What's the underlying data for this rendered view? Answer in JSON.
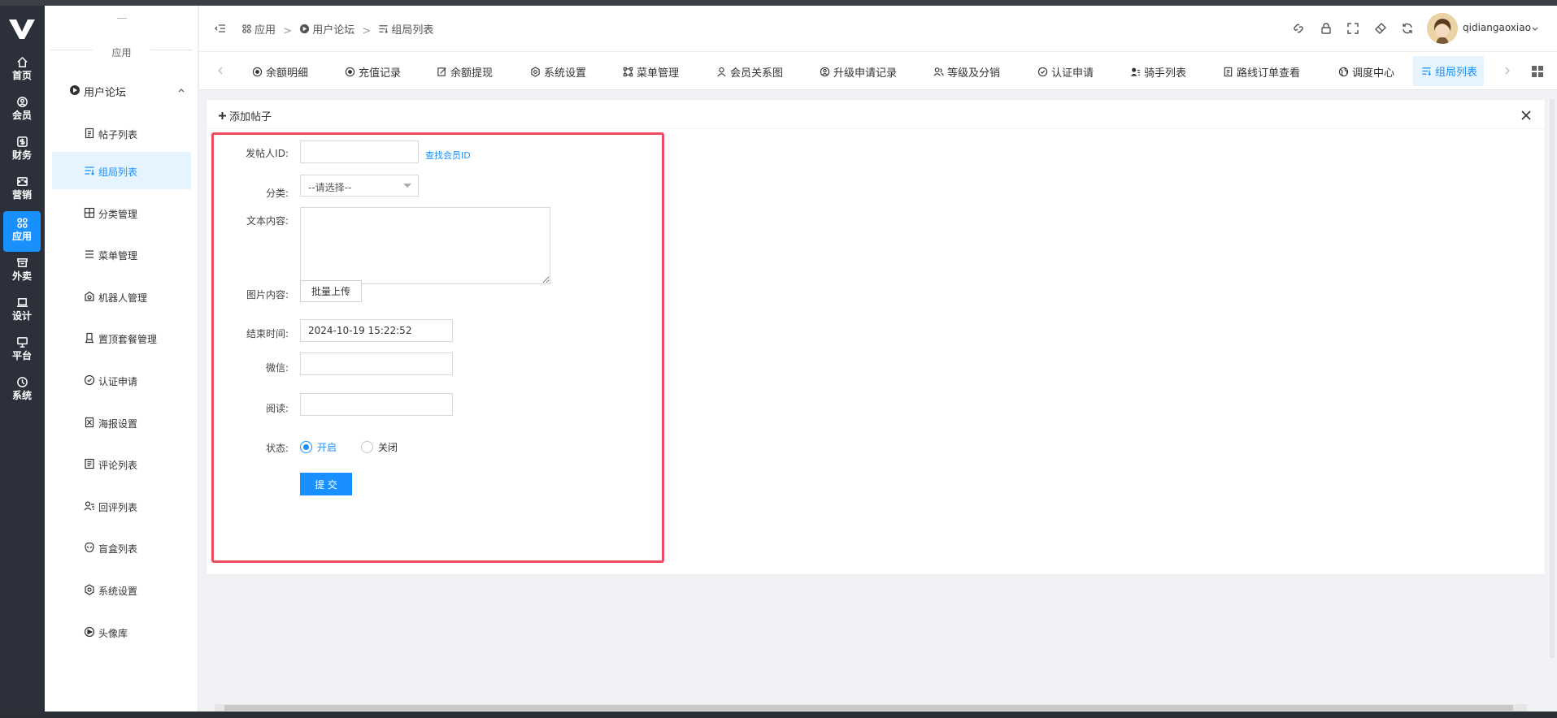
{
  "rail": {
    "items": [
      {
        "label": "首页",
        "icon": "home-icon"
      },
      {
        "label": "会员",
        "icon": "member-icon"
      },
      {
        "label": "财务",
        "icon": "finance-icon"
      },
      {
        "label": "营销",
        "icon": "marketing-icon"
      },
      {
        "label": "应用",
        "icon": "apps-icon"
      },
      {
        "label": "外卖",
        "icon": "takeout-icon"
      },
      {
        "label": "设计",
        "icon": "design-icon"
      },
      {
        "label": "平台",
        "icon": "platform-icon"
      },
      {
        "label": "系统",
        "icon": "system-icon"
      }
    ],
    "active_index": 4
  },
  "menu": {
    "section_label": "应用",
    "group_label": "用户论坛",
    "items": [
      {
        "label": "帖子列表"
      },
      {
        "label": "组局列表"
      },
      {
        "label": "分类管理"
      },
      {
        "label": "菜单管理"
      },
      {
        "label": "机器人管理"
      },
      {
        "label": "置顶套餐管理"
      },
      {
        "label": "认证申请"
      },
      {
        "label": "海报设置"
      },
      {
        "label": "评论列表"
      },
      {
        "label": "回评列表"
      },
      {
        "label": "盲盒列表"
      },
      {
        "label": "系统设置"
      },
      {
        "label": "头像库"
      }
    ],
    "active_index": 1
  },
  "header": {
    "breadcrumb": [
      "应用",
      "用户论坛",
      "组局列表"
    ],
    "breadcrumb_sep": ">",
    "username": "qidiangaoxiao"
  },
  "tabs": {
    "items": [
      {
        "label": "余额明细"
      },
      {
        "label": "充值记录"
      },
      {
        "label": "余额提现"
      },
      {
        "label": "系统设置"
      },
      {
        "label": "菜单管理"
      },
      {
        "label": "会员关系图"
      },
      {
        "label": "升级申请记录"
      },
      {
        "label": "等级及分销"
      },
      {
        "label": "认证申请"
      },
      {
        "label": "骑手列表"
      },
      {
        "label": "路线订单查看"
      },
      {
        "label": "调度中心"
      },
      {
        "label": "组局列表"
      }
    ],
    "active_index": 12
  },
  "form": {
    "title": "添加帖子",
    "poster_id_label": "发帖人ID:",
    "poster_id_value": "",
    "find_member_link": "查找会员ID",
    "category_label": "分类:",
    "category_selected": "--请选择--",
    "content_label": "文本内容:",
    "content_value": "",
    "images_label": "图片内容:",
    "upload_button": "批量上传",
    "end_time_label": "结束时间:",
    "end_time_value": "2024-10-19 15:22:52",
    "wechat_label": "微信:",
    "wechat_value": "",
    "read_label": "阅读:",
    "read_value": "",
    "status_label": "状态:",
    "status_options": [
      "开启",
      "关闭"
    ],
    "status_selected": "开启",
    "submit_button": "提 交"
  },
  "colors": {
    "accent": "#1890ff",
    "rail_bg": "#2b303b",
    "highlight_border": "#ee4b5f"
  }
}
